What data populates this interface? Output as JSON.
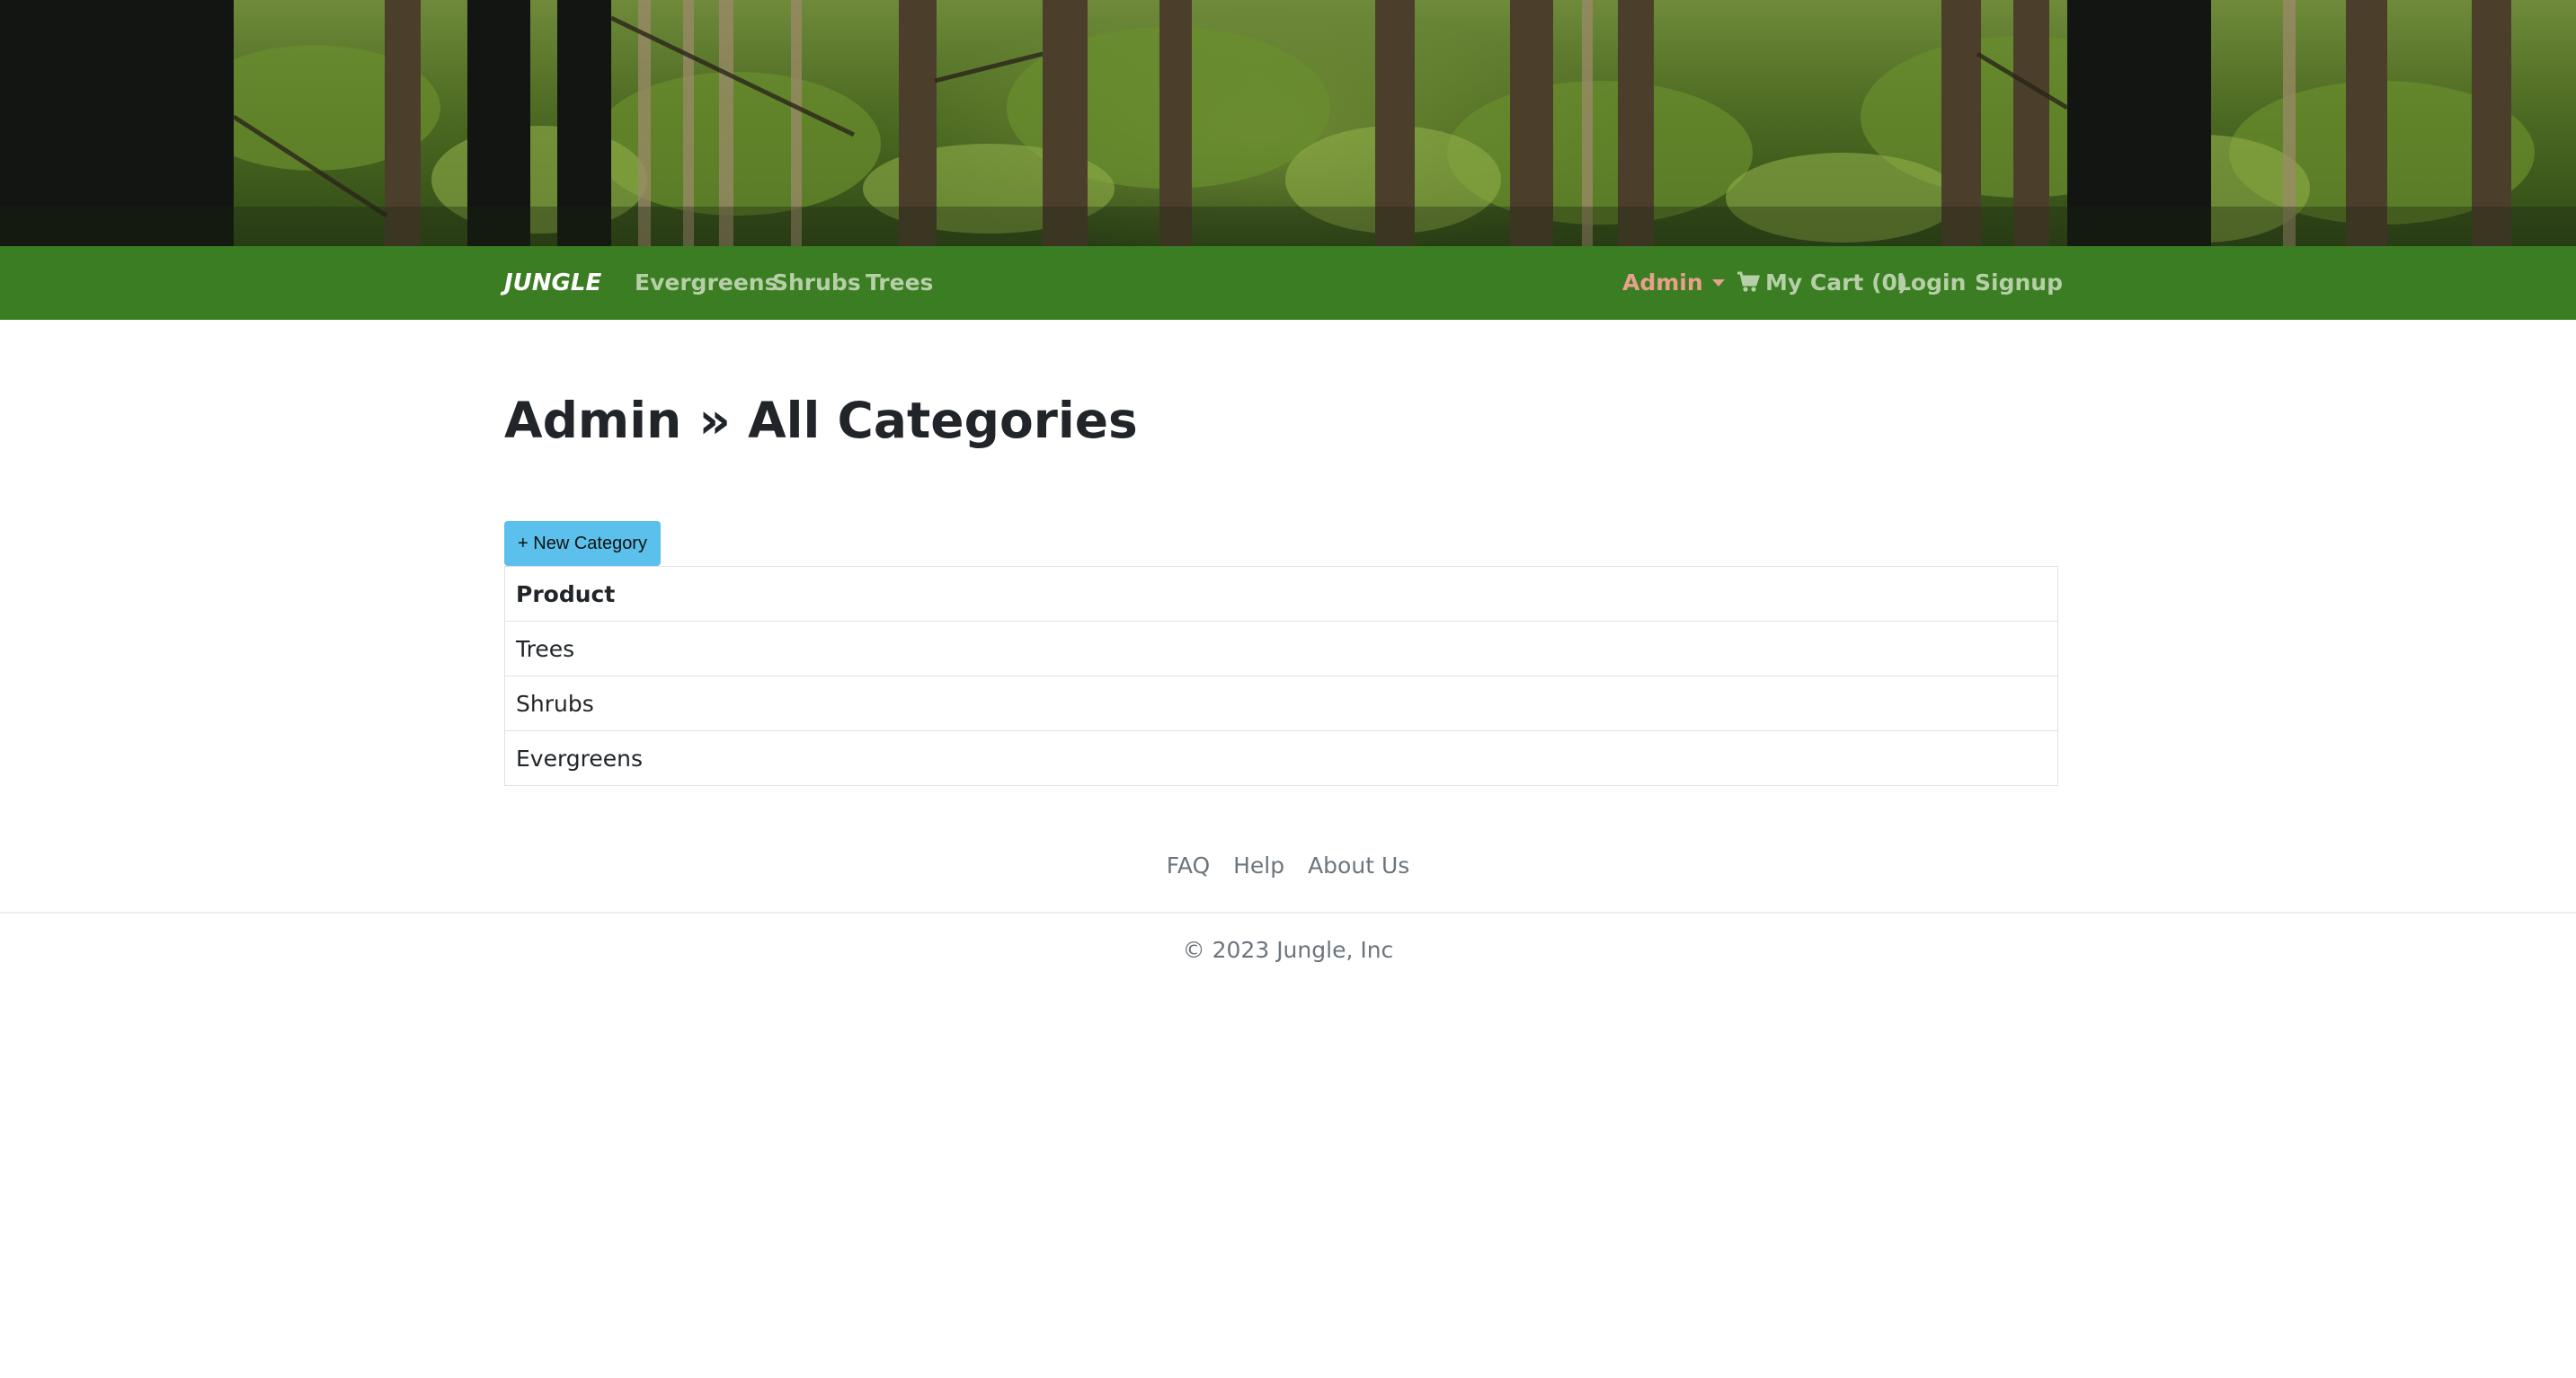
{
  "banner": {
    "alt": "forest banner"
  },
  "nav": {
    "brand": "JUNGLE",
    "links": [
      "Evergreens",
      "Shrubs",
      "Trees"
    ],
    "admin_label": "Admin",
    "cart_label": "My Cart (0)",
    "login_label": "Login",
    "signup_label": "Signup"
  },
  "main": {
    "title": "Admin » All Categories",
    "new_button_label": "+ New Category",
    "table": {
      "header": "Product",
      "rows": [
        "Trees",
        "Shrubs",
        "Evergreens"
      ]
    }
  },
  "footer": {
    "links": [
      "FAQ",
      "Help",
      "About Us"
    ],
    "copyright": "© 2023 Jungle, Inc"
  },
  "colors": {
    "navbar": "#3a7d22",
    "nav_link": "#b6cfa7",
    "admin_link": "#e8a08c",
    "button": "#5bc0eb"
  }
}
